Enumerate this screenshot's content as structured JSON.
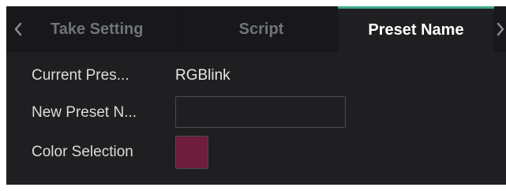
{
  "tabs": {
    "items": [
      {
        "label": "Take Setting"
      },
      {
        "label": "Script"
      },
      {
        "label": "Preset Name"
      }
    ],
    "active_index": 2,
    "prev_icon": "chevron-left-icon",
    "next_icon": "chevron-right-icon"
  },
  "form": {
    "current_preset": {
      "label": "Current Pres...",
      "value": "RGBlink"
    },
    "new_preset_name": {
      "label": "New Preset N...",
      "value": "",
      "placeholder": ""
    },
    "color_selection": {
      "label": "Color Selection",
      "color": "#6e1d3a"
    }
  },
  "colors": {
    "background": "#1f1f21",
    "tab_bar": "#18181a",
    "active_tab_accent": "#3fa78c"
  }
}
